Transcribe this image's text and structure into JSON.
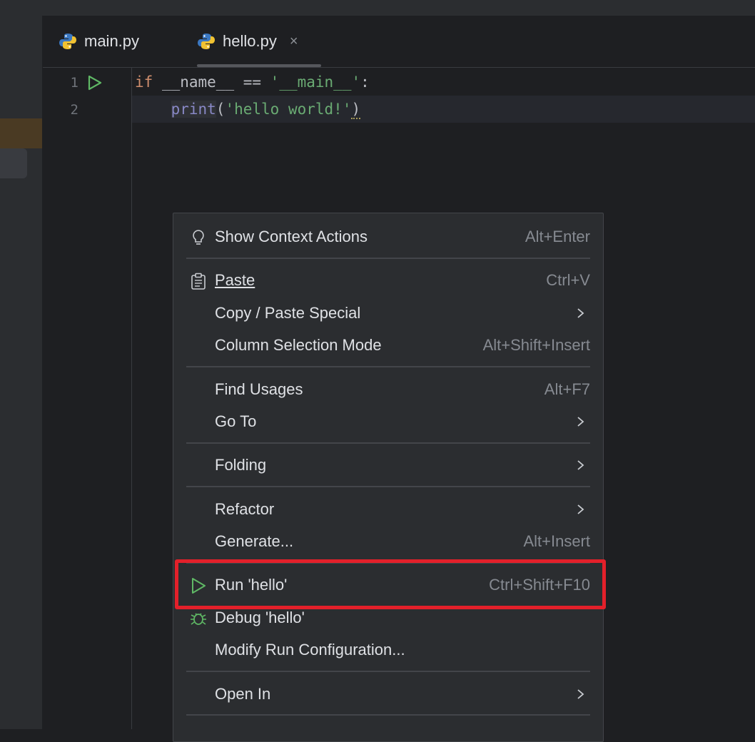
{
  "tabs": [
    {
      "label": "main.py",
      "icon": "python-file-icon"
    },
    {
      "label": "hello.py",
      "icon": "python-file-icon",
      "active": true,
      "close_glyph": "×"
    }
  ],
  "editor": {
    "line_numbers": [
      "1",
      "2"
    ],
    "line1": {
      "kw": "if",
      "a": " __name__ == ",
      "s": "'__main__'",
      "b": ":"
    },
    "line2": {
      "indent": "    ",
      "fn": "print",
      "p1": "(",
      "s": "'hello world!'",
      "p2": ")"
    }
  },
  "context_menu": {
    "show_context_actions": {
      "label": "Show Context Actions",
      "shortcut": "Alt+Enter",
      "icon": "lightbulb-icon"
    },
    "paste": {
      "label": "Paste",
      "shortcut": "Ctrl+V",
      "icon": "clipboard-icon"
    },
    "copy_paste_special": {
      "label": "Copy / Paste Special"
    },
    "column_selection": {
      "label": "Column Selection Mode",
      "shortcut": "Alt+Shift+Insert"
    },
    "find_usages": {
      "label": "Find Usages",
      "shortcut": "Alt+F7"
    },
    "go_to": {
      "label": "Go To"
    },
    "folding": {
      "label": "Folding"
    },
    "refactor": {
      "label": "Refactor"
    },
    "generate": {
      "label": "Generate...",
      "shortcut": "Alt+Insert"
    },
    "run": {
      "label": "Run 'hello'",
      "shortcut": "Ctrl+Shift+F10",
      "icon": "run-icon",
      "highlighted": true
    },
    "debug": {
      "label": "Debug 'hello'",
      "icon": "debug-icon"
    },
    "modify_run": {
      "label": "Modify Run Configuration..."
    },
    "open_in": {
      "label": "Open In"
    }
  },
  "colors": {
    "highlight_box": "#e3202a",
    "run_green": "#5fb865",
    "menu_bg": "#2b2d30",
    "editor_bg": "#1e1f22"
  }
}
